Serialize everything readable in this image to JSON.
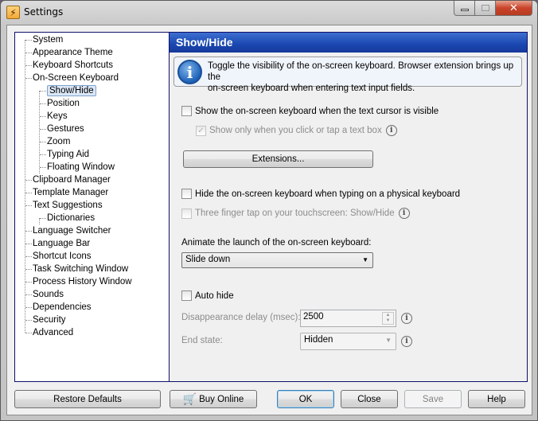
{
  "window": {
    "title": "Settings",
    "icon": "lightning-bolt-icon",
    "controls": {
      "minimize": "—",
      "maximize": "▭",
      "close": "✕"
    }
  },
  "sidebar": {
    "items": [
      {
        "label": "System",
        "level": 0
      },
      {
        "label": "Appearance Theme",
        "level": 0
      },
      {
        "label": "Keyboard Shortcuts",
        "level": 0
      },
      {
        "label": "On-Screen Keyboard",
        "level": 0
      },
      {
        "label": "Show/Hide",
        "level": 1,
        "selected": true
      },
      {
        "label": "Position",
        "level": 1
      },
      {
        "label": "Keys",
        "level": 1
      },
      {
        "label": "Gestures",
        "level": 1
      },
      {
        "label": "Zoom",
        "level": 1
      },
      {
        "label": "Typing Aid",
        "level": 1
      },
      {
        "label": "Floating Window",
        "level": 1
      },
      {
        "label": "Clipboard Manager",
        "level": 0
      },
      {
        "label": "Template Manager",
        "level": 0
      },
      {
        "label": "Text Suggestions",
        "level": 0
      },
      {
        "label": "Dictionaries",
        "level": 1
      },
      {
        "label": "Language Switcher",
        "level": 0
      },
      {
        "label": "Language Bar",
        "level": 0
      },
      {
        "label": "Shortcut Icons",
        "level": 0
      },
      {
        "label": "Task Switching Window",
        "level": 0
      },
      {
        "label": "Process History Window",
        "level": 0
      },
      {
        "label": "Sounds",
        "level": 0
      },
      {
        "label": "Dependencies",
        "level": 0
      },
      {
        "label": "Security",
        "level": 0
      },
      {
        "label": "Advanced",
        "level": 0
      }
    ]
  },
  "panel": {
    "title": "Show/Hide",
    "info_line1": "Toggle the visibility of the on-screen keyboard. Browser extension brings up the",
    "info_line2": "on-screen keyboard when entering text input fields.",
    "show_when_cursor": {
      "label": "Show the on-screen keyboard when the text cursor is visible",
      "checked": false
    },
    "show_only_click": {
      "label": "Show only when you click or tap a text box",
      "checked": true,
      "disabled": true
    },
    "extensions_button": "Extensions...",
    "hide_when_typing": {
      "label": "Hide the on-screen keyboard when typing on a physical keyboard",
      "checked": false
    },
    "three_finger_tap": {
      "label": "Three finger tap on your touchscreen: Show/Hide",
      "checked": false,
      "disabled": true
    },
    "animate_label": "Animate the launch of the on-screen keyboard:",
    "animate_value": "Slide down",
    "auto_hide": {
      "label": "Auto hide",
      "checked": false
    },
    "delay_label": "Disappearance delay (msec):",
    "delay_value": "2500",
    "end_state_label": "End state:",
    "end_state_value": "Hidden"
  },
  "footer": {
    "restore_defaults": "Restore Defaults",
    "buy_online": "Buy Online",
    "ok": "OK",
    "close": "Close",
    "save": "Save",
    "help": "Help"
  },
  "colors": {
    "header_blue": "#1a47b0",
    "border_navy": "#10106a",
    "selection": "#dbe7f7"
  }
}
